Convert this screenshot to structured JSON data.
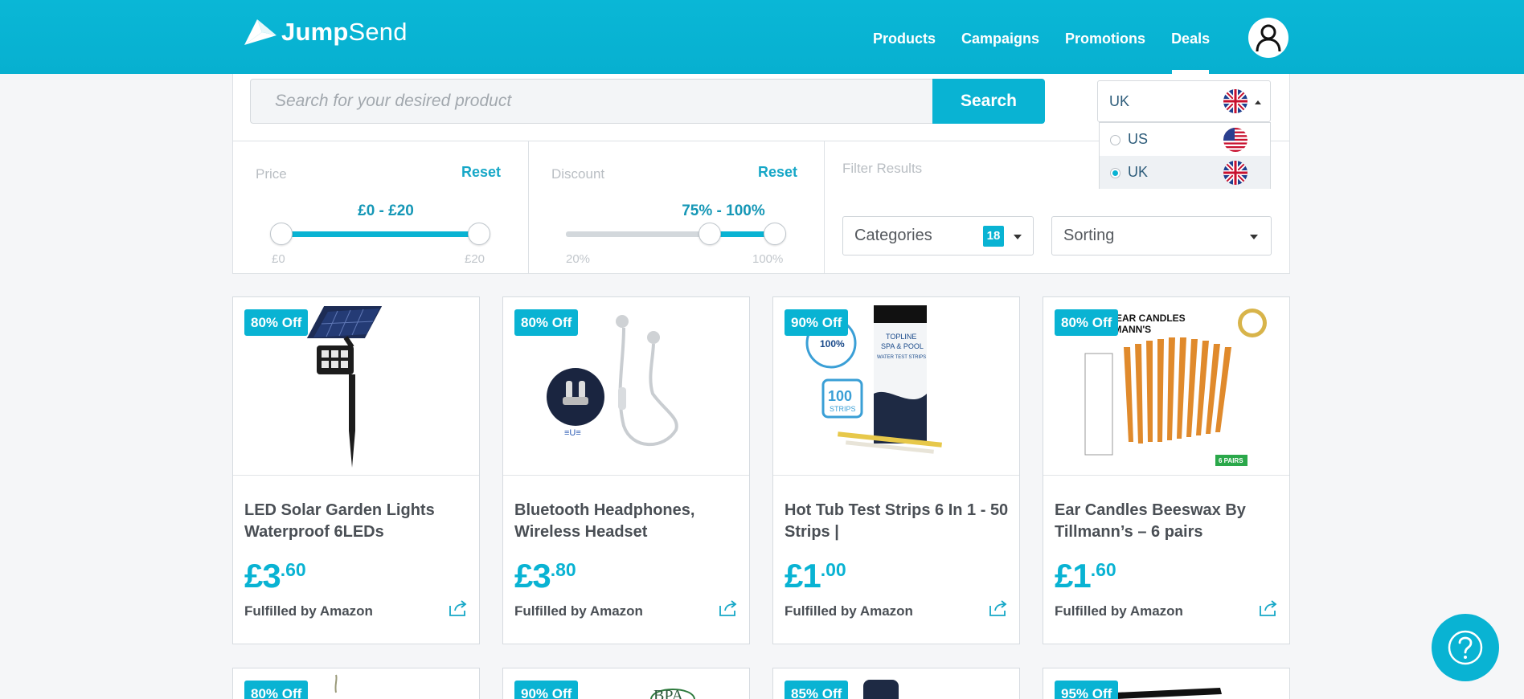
{
  "header": {
    "brand_bold": "Jump",
    "brand_light": "Send",
    "nav": [
      "Products",
      "Campaigns",
      "Promotions",
      "Deals"
    ],
    "active_nav": "Deals",
    "avatar_icon": "user-icon"
  },
  "search": {
    "placeholder": "Search for your desired product",
    "button_label": "Search"
  },
  "country": {
    "selected": "UK",
    "options": [
      {
        "label": "US",
        "flag": "us-flag-icon",
        "selected": false
      },
      {
        "label": "UK",
        "flag": "uk-flag-icon",
        "selected": true
      }
    ]
  },
  "filters": {
    "price": {
      "title": "Price",
      "reset": "Reset",
      "range": "£0 - £20",
      "min_tick": "£0",
      "max_tick": "£20",
      "low": 0,
      "high": 20,
      "min": 0,
      "max": 20
    },
    "discount": {
      "title": "Discount",
      "reset": "Reset",
      "range": "75% - 100%",
      "min_tick": "20%",
      "max_tick": "100%",
      "low": 75,
      "high": 100,
      "min": 20,
      "max": 100
    },
    "results": {
      "title": "Filter Results",
      "categories_label": "Categories",
      "categories_count": "18",
      "sorting_label": "Sorting"
    }
  },
  "products": [
    {
      "badge": "80% Off",
      "title": "LED Solar Garden Lights Waterproof 6LEDs",
      "price_major": "£3",
      "price_minor": ".60",
      "fulfilled": "Fulfilled by Amazon"
    },
    {
      "badge": "80% Off",
      "title": "Bluetooth Headphones, Wireless Headset",
      "price_major": "£3",
      "price_minor": ".80",
      "fulfilled": "Fulfilled by Amazon"
    },
    {
      "badge": "90% Off",
      "title": "Hot Tub Test Strips 6 In 1 - 50 Strips |",
      "price_major": "£1",
      "price_minor": ".00",
      "fulfilled": "Fulfilled by Amazon",
      "image_text": {
        "seal": "100%",
        "box": "100",
        "box_sub": "STRIPS",
        "brand1": "TOPLINE",
        "brand2": "SPA & POOL",
        "brand3": "WATER TEST STRIPS"
      }
    },
    {
      "badge": "80% Off",
      "title": "Ear Candles Beeswax By Tillmann’s – 6 pairs",
      "price_major": "£1",
      "price_minor": ".60",
      "fulfilled": "Fulfilled by Amazon",
      "image_text": {
        "line1": "CES EAR CANDLES",
        "line2": "TILLMANN'S",
        "pairs": "6 PAIRS"
      }
    }
  ],
  "products_row2": [
    {
      "badge": "80% Off"
    },
    {
      "badge": "90% Off",
      "image_text": "BPA"
    },
    {
      "badge": "85% Off"
    },
    {
      "badge": "95% Off"
    }
  ],
  "help_icon": "help-icon",
  "colors": {
    "accent": "#09b3d3",
    "header": "#0ab7d6"
  }
}
